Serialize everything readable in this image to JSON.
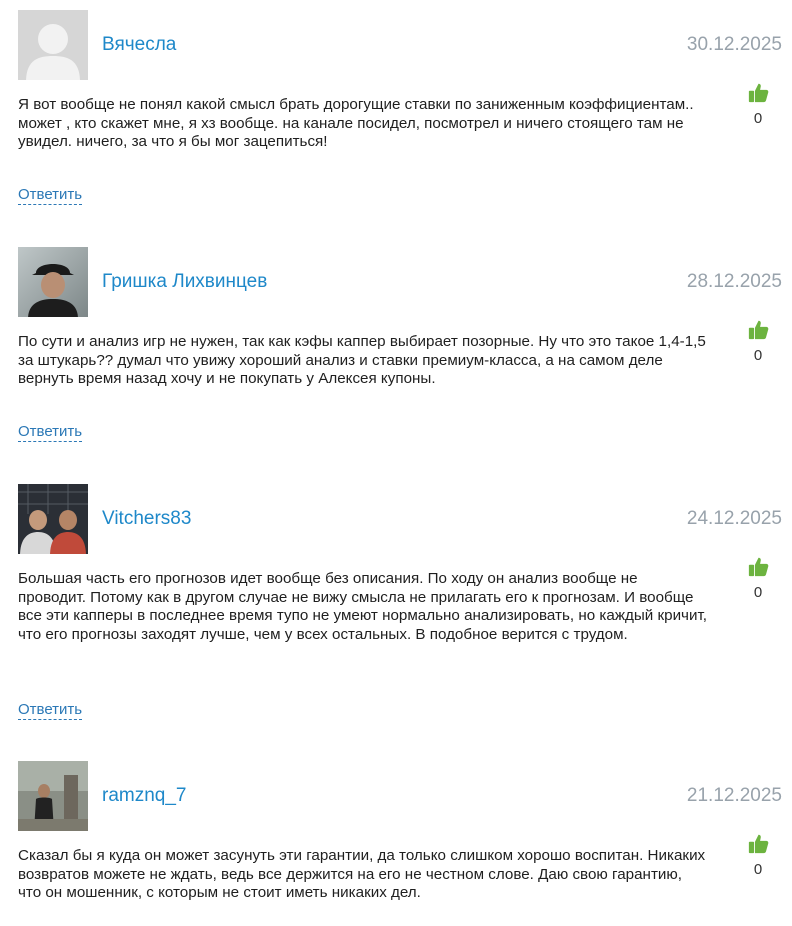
{
  "reply_label": "Ответить",
  "comments": [
    {
      "author": "Вячесла",
      "date": "30.12.2025",
      "likes": "0",
      "avatar": "default-avatar",
      "text": "Я вот вообще не понял какой смысл брать дорогущие ставки по заниженным коэффициентам.. может , кто скажет мне, я хз вообще. на канале посидел, посмотрел и ничего стоящего там не увидел. ничего, за что я бы мог зацепиться!"
    },
    {
      "author": "Гришка Лихвинцев",
      "date": "28.12.2025",
      "likes": "0",
      "avatar": "photo-avatar",
      "text": "По сути и анализ игр не нужен, так как кэфы каппер выбирает позорные. Ну что это такое 1,4-1,5 за штукарь?? думал что увижу хороший анализ и ставки премиум-класса, а на самом деле вернуть время назад хочу и не покупать у Алексея купоны."
    },
    {
      "author": "Vitchers83",
      "date": "24.12.2025",
      "likes": "0",
      "avatar": "photo-avatar",
      "text": "Большая часть его прогнозов идет вообще без описания. По ходу он анализ вообще не проводит. Потому как в другом случае не вижу смысла не прилагать его к прогнозам. И вообще все эти капперы в последнее время тупо не умеют нормально анализировать, но каждый кричит, что его прогнозы заходят лучше, чем у всех остальных. В подобное верится с трудом."
    },
    {
      "author": "ramznq_7",
      "date": "21.12.2025",
      "likes": "0",
      "avatar": "photo-avatar",
      "text": "Сказал бы я куда он может засунуть эти гарантии, да только слишком хорошо воспитан. Никаких возвратов можете не ждать, ведь все держится на его не честном слове. Даю свою гарантию, что он мошенник, с которым не стоит иметь никаких дел."
    }
  ],
  "colors": {
    "author": "#1e88c9",
    "date": "#98a2ab",
    "like": "#6cb33f",
    "reply": "#2b78b6"
  }
}
